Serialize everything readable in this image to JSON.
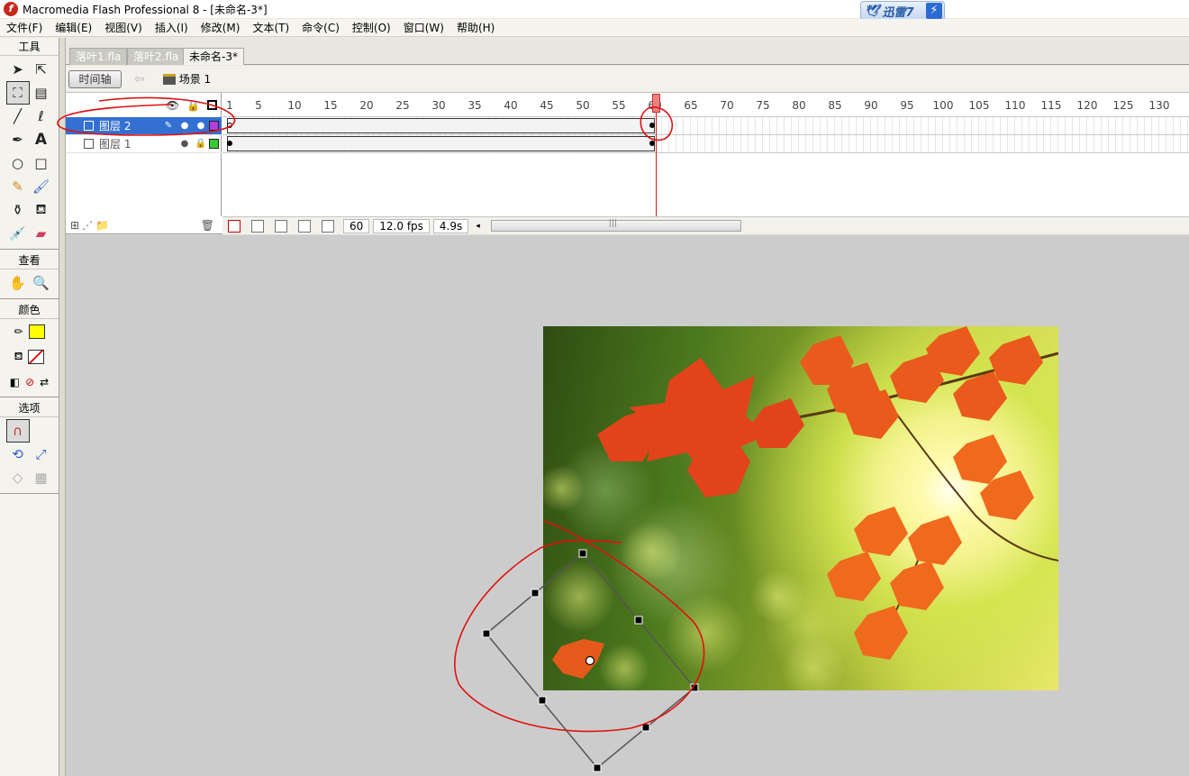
{
  "window": {
    "title": "Macromedia Flash Professional 8 - [未命名-3*]",
    "logo": "f"
  },
  "thunder": {
    "label": "迅雷7",
    "bird": "🕊",
    "bolt": "⚡"
  },
  "menu": [
    "文件(F)",
    "编辑(E)",
    "视图(V)",
    "插入(I)",
    "修改(M)",
    "文本(T)",
    "命令(C)",
    "控制(O)",
    "窗口(W)",
    "帮助(H)"
  ],
  "tools": {
    "title": "工具",
    "view_title": "查看",
    "color_title": "颜色",
    "options_title": "选项"
  },
  "tabs": [
    "落叶1.fla",
    "落叶2.fla",
    "未命名-3*"
  ],
  "editbar": {
    "timeline_label": "时间轴",
    "scene_label": "场景 1"
  },
  "timeline": {
    "ruler_ticks": [
      "1",
      "5",
      "10",
      "15",
      "20",
      "25",
      "30",
      "35",
      "40",
      "45",
      "50",
      "55",
      "60",
      "65",
      "70",
      "75",
      "80",
      "85",
      "90",
      "95",
      "100",
      "105",
      "110",
      "115",
      "120",
      "125",
      "130"
    ],
    "layers": [
      {
        "name": "图层 2",
        "selected": true,
        "color": "#b040d8"
      },
      {
        "name": "图层 1",
        "selected": false,
        "color": "#33cc33"
      }
    ],
    "current_frame": "60",
    "fps": "12.0 fps",
    "elapsed": "4.9s"
  },
  "colors": {
    "stroke": "#000000",
    "fill": "#ffff00",
    "annotation": "#e01010",
    "selection": "#3470d2"
  }
}
